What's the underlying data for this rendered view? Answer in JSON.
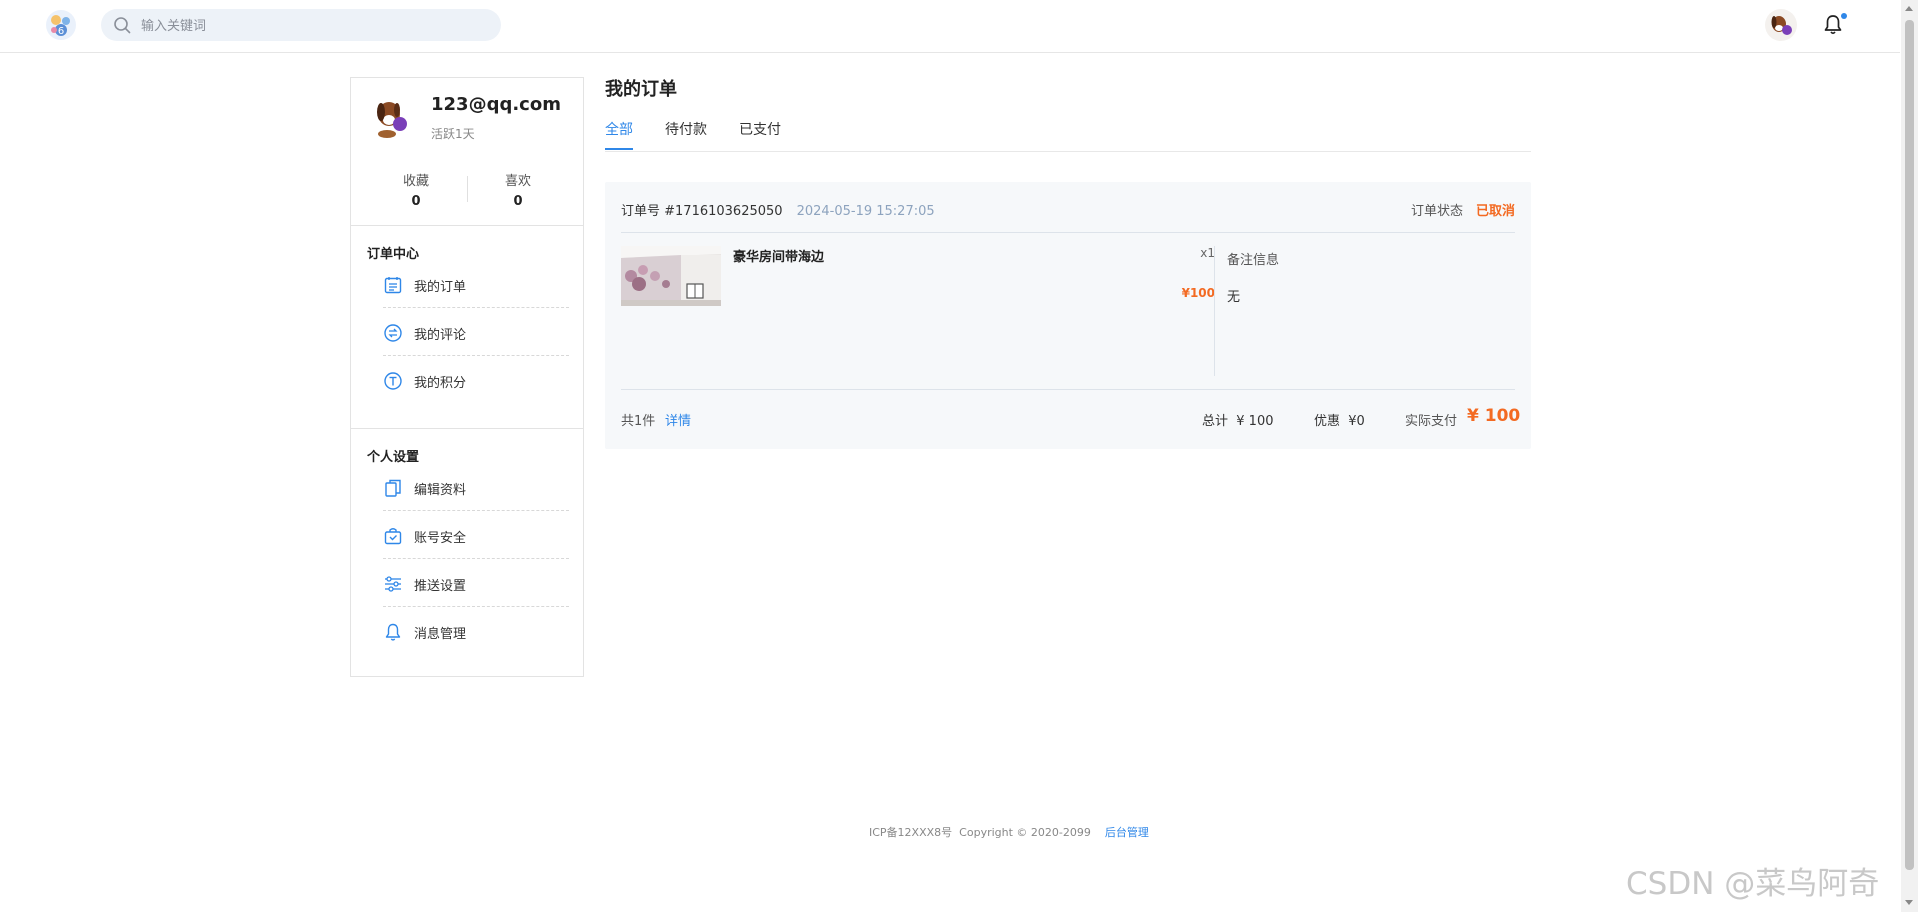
{
  "header": {
    "search_placeholder": "输入关键词",
    "icons": {
      "logo": "site-logo",
      "search": "search-icon",
      "avatar": "user-avatar",
      "bell": "bell-icon"
    }
  },
  "profile": {
    "email": "123@qq.com",
    "active": "活跃1天",
    "favorites_label": "收藏",
    "favorites_count": "0",
    "likes_label": "喜欢",
    "likes_count": "0"
  },
  "sidebar": {
    "order_center_title": "订单中心",
    "order_items": [
      {
        "label": "我的订单",
        "icon": "calendar-list-icon"
      },
      {
        "label": "我的评论",
        "icon": "comment-swap-icon"
      },
      {
        "label": "我的积分",
        "icon": "points-t-icon"
      }
    ],
    "settings_title": "个人设置",
    "settings_items": [
      {
        "label": "编辑资料",
        "icon": "copy-document-icon"
      },
      {
        "label": "账号安全",
        "icon": "shield-bag-icon"
      },
      {
        "label": "推送设置",
        "icon": "sliders-icon"
      },
      {
        "label": "消息管理",
        "icon": "bell-icon"
      }
    ]
  },
  "main": {
    "title": "我的订单",
    "tabs": [
      {
        "label": "全部",
        "active": true
      },
      {
        "label": "待付款",
        "active": false
      },
      {
        "label": "已支付",
        "active": false
      }
    ]
  },
  "order": {
    "number_prefix": "订单号 ",
    "number": "#1716103625050",
    "datetime": "2024-05-19 15:27:05",
    "status_label": "订单状态",
    "status_value": "已取消",
    "product_name": "豪华房间带海边",
    "quantity": "x1",
    "price": "¥100",
    "note_title": "备注信息",
    "note_value": "无",
    "count_text": "共1件",
    "detail_link": "详情",
    "total_label": "总计",
    "total_value": "¥ 100",
    "discount_label": "优惠",
    "discount_value": "¥0",
    "paid_label": "实际支付",
    "paid_value": "¥ 100"
  },
  "footer": {
    "icp": "ICP备12XXX8号",
    "copyright": "Copyright © 2020-2099",
    "admin_link": "后台管理"
  },
  "watermark": "CSDN @菜鸟阿奇",
  "colors": {
    "accent": "#2f87e8",
    "price": "#f36a22"
  }
}
